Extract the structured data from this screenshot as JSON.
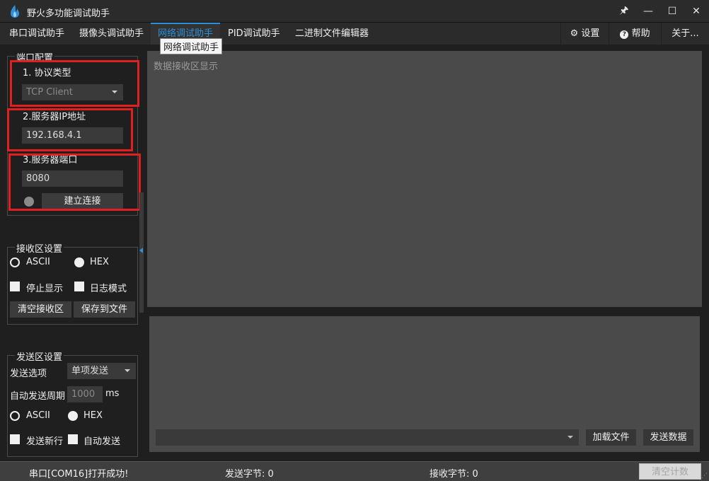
{
  "app": {
    "title": "野火多功能调试助手"
  },
  "window_controls": {
    "pin": "🖈",
    "minimize": "—",
    "maximize": "☐",
    "close": "✕"
  },
  "tabs": [
    {
      "label": "串口调试助手"
    },
    {
      "label": "摄像头调试助手"
    },
    {
      "label": "网络调试助手",
      "active": true
    },
    {
      "label": "PID调试助手"
    },
    {
      "label": "二进制文件编辑器"
    }
  ],
  "tabs_right": {
    "settings": {
      "label": "设置",
      "icon": "gear-icon"
    },
    "help": {
      "label": "帮助",
      "icon": "question-icon"
    },
    "about": {
      "label": "关于..."
    }
  },
  "tooltip": "网络调试助手",
  "port_config": {
    "title": "端口配置",
    "protocol_label": "1. 协议类型",
    "protocol_value": "TCP Client",
    "server_ip_label": "2.服务器IP地址",
    "server_ip_value": "192.168.4.1",
    "server_port_label": "3.服务器端口",
    "server_port_value": "8080",
    "connect_button": "建立连接"
  },
  "recv_settings": {
    "title": "接收区设置",
    "ascii_label": "ASCII",
    "hex_label": "HEX",
    "selected_format": "HEX",
    "stop_display_label": "停止显示",
    "log_mode_label": "日志模式",
    "clear_button": "清空接收区",
    "save_button": "保存到文件"
  },
  "send_settings": {
    "title": "发送区设置",
    "send_option_label": "发送选项",
    "send_option_value": "单项发送",
    "auto_period_label": "自动发送周期",
    "auto_period_value": "1000",
    "auto_period_unit": "ms",
    "ascii_label": "ASCII",
    "hex_label": "HEX",
    "selected_format": "HEX",
    "newline_label": "发送新行",
    "auto_send_label": "自动发送"
  },
  "recv_area": {
    "placeholder": "数据接收区显示"
  },
  "send_area": {
    "load_file_button": "加载文件",
    "send_data_button": "发送数据"
  },
  "status_bar": {
    "message": "串口[COM16]打开成功!",
    "sent_bytes": "发送字节: 0",
    "recv_bytes": "接收字节: 0",
    "clear_count_button": "清空计数"
  },
  "colors": {
    "accent": "#2f8fd8",
    "highlight_box": "#e02020",
    "background": "#1f1f1f",
    "panel": "#4a4a4a"
  }
}
